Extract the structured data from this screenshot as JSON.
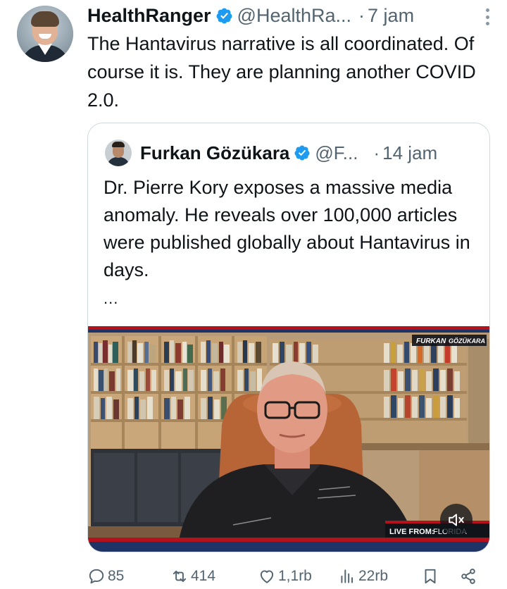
{
  "tweet": {
    "display_name": "HealthRanger",
    "handle": "@HealthRa...",
    "separator": "·",
    "time": "7 jam",
    "text": "The Hantavirus narrative is all coordinated. Of course it is. They are planning another COVID 2.0."
  },
  "quote": {
    "display_name": "Furkan Gözükara",
    "handle": "@F...",
    "separator": "·",
    "time": "14 jam",
    "text": "Dr. Pierre Kory exposes a massive media anomaly. He reveals over 100,000 articles were published globally about Hantavirus in days.",
    "ellipsis": "...",
    "video": {
      "channel_logo_left": "FURKAN",
      "channel_logo_right": "GÖZÜKARA",
      "live_label": "LIVE FROM:",
      "live_location": "FLORIDA",
      "mute_icon": "speaker-muted-icon"
    }
  },
  "actions": {
    "replies": "85",
    "reposts": "414",
    "likes": "1,1rb",
    "views": "22rb"
  },
  "colors": {
    "verified": "#1d9bf0",
    "secondary_text": "#536471",
    "primary_text": "#0f1419",
    "border": "#cfd9de"
  }
}
